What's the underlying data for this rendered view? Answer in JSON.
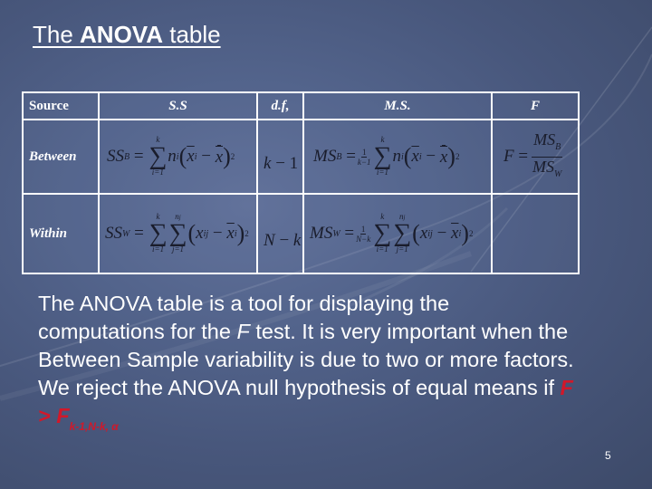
{
  "slide": {
    "title": {
      "prefix": "The ",
      "bold": "ANOVA",
      "suffix": " table"
    },
    "page_number": "5",
    "colors": {
      "background": "#4a5a7e",
      "text": "#ffffff",
      "formula_text": "#1a1d2c",
      "highlight_red": "#d1182a",
      "table_border": "#ffffff"
    }
  },
  "table": {
    "headers": [
      "Source",
      "S.S",
      "d.f,",
      "M.S.",
      "F"
    ],
    "rows": [
      {
        "source": "Between",
        "ss": {
          "lhs": "SS",
          "lhs_sub": "B",
          "sum_upper": "k",
          "sum_lower": "i=1",
          "term": "n",
          "term_sub": "i",
          "x": "x",
          "x_sub": "i",
          "grand": "x",
          "power": "2"
        },
        "df": {
          "a": "k",
          "op": " − ",
          "b": "1"
        },
        "ms": {
          "lhs": "MS",
          "lhs_sub": "B",
          "frac_num": "1",
          "frac_den": "k−1",
          "sum_upper": "k",
          "sum_lower": "i=1",
          "term": "n",
          "term_sub": "i",
          "x": "x",
          "x_sub": "i",
          "grand": "x",
          "power": "2"
        },
        "f": {
          "lhs": "F",
          "num": "MS",
          "num_sub": "B",
          "den": "MS",
          "den_sub": "W"
        }
      },
      {
        "source": "Within",
        "ss": {
          "lhs": "SS",
          "lhs_sub": "W",
          "sum1_upper": "k",
          "sum1_lower": "i=1",
          "sum2_upper": "n",
          "sum2_upper_sub": "j",
          "sum2_lower": "j=1",
          "x": "x",
          "x_sub": "ij",
          "xbar": "x",
          "xbar_sub": "i",
          "power": "2"
        },
        "df": {
          "a": "N",
          "op": " − ",
          "b": "k"
        },
        "ms": {
          "lhs": "MS",
          "lhs_sub": "W",
          "frac_num": "1",
          "frac_den": "N−k",
          "sum1_upper": "k",
          "sum1_lower": "i=1",
          "sum2_upper": "n",
          "sum2_upper_sub": "j",
          "sum2_lower": "j=1",
          "x": "x",
          "x_sub": "ij",
          "xbar": "x",
          "xbar_sub": "i",
          "power": "2"
        },
        "f": null
      }
    ]
  },
  "paragraph": {
    "part1": "The ANOVA table is a tool for displaying the computations for the ",
    "f_italic": "F",
    "part2": " test. It is very important when the Between Sample variability is due to two or more factors. We reject the ANOVA null hypothesis of equal means if ",
    "criterion": {
      "lhs": "F",
      "op": " > ",
      "rhs": "F",
      "sub": "k-1,N-k, α"
    }
  }
}
